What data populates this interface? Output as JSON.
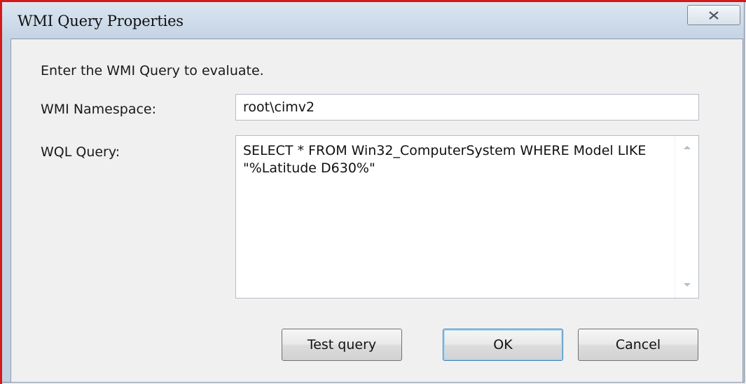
{
  "window": {
    "title": "WMI Query Properties"
  },
  "dialog": {
    "instructions": "Enter the WMI Query to evaluate.",
    "namespace": {
      "label": "WMI Namespace:",
      "value": "root\\cimv2"
    },
    "query": {
      "label": "WQL Query:",
      "value": "SELECT * FROM Win32_ComputerSystem WHERE Model LIKE \"%Latitude D630%\""
    }
  },
  "buttons": {
    "test_query": "Test query",
    "ok": "OK",
    "cancel": "Cancel"
  },
  "icons": {
    "close": "close-icon",
    "scroll_up": "scroll-up-arrow-icon",
    "scroll_down": "scroll-down-arrow-icon"
  },
  "colors": {
    "annotation_frame": "#d21a1a",
    "default_button_border": "#3c7fb1"
  }
}
